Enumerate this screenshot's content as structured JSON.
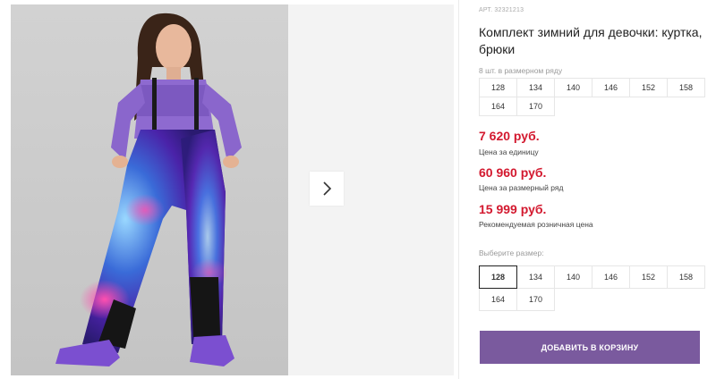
{
  "gallery": {
    "image_alt": "girl in purple winter suit",
    "next_icon": "chevron-right-icon"
  },
  "product": {
    "article": "АРТ. 32321213",
    "title": "Комплект зимний для девочки: куртка, брюки",
    "pack_label": "8 шт. в размерном ряду",
    "pack_sizes": [
      "128",
      "134",
      "140",
      "146",
      "152",
      "158",
      "164",
      "170"
    ]
  },
  "prices": {
    "unit_price": "7 620 руб.",
    "unit_caption": "Цена за единицу",
    "pack_price": "60 960 руб.",
    "pack_caption": "Цена за размерный ряд",
    "retail_price": "15 999 руб.",
    "retail_caption": "Рекомендуемая розничная цена",
    "price_color": "#d3192f"
  },
  "size_select": {
    "label": "Выберите размер:",
    "sizes": [
      "128",
      "134",
      "140",
      "146",
      "152",
      "158",
      "164",
      "170"
    ],
    "selected": "128"
  },
  "cart": {
    "button_label": "ДОБАВИТЬ В КОРЗИНУ",
    "button_color": "#7a5a9e"
  }
}
